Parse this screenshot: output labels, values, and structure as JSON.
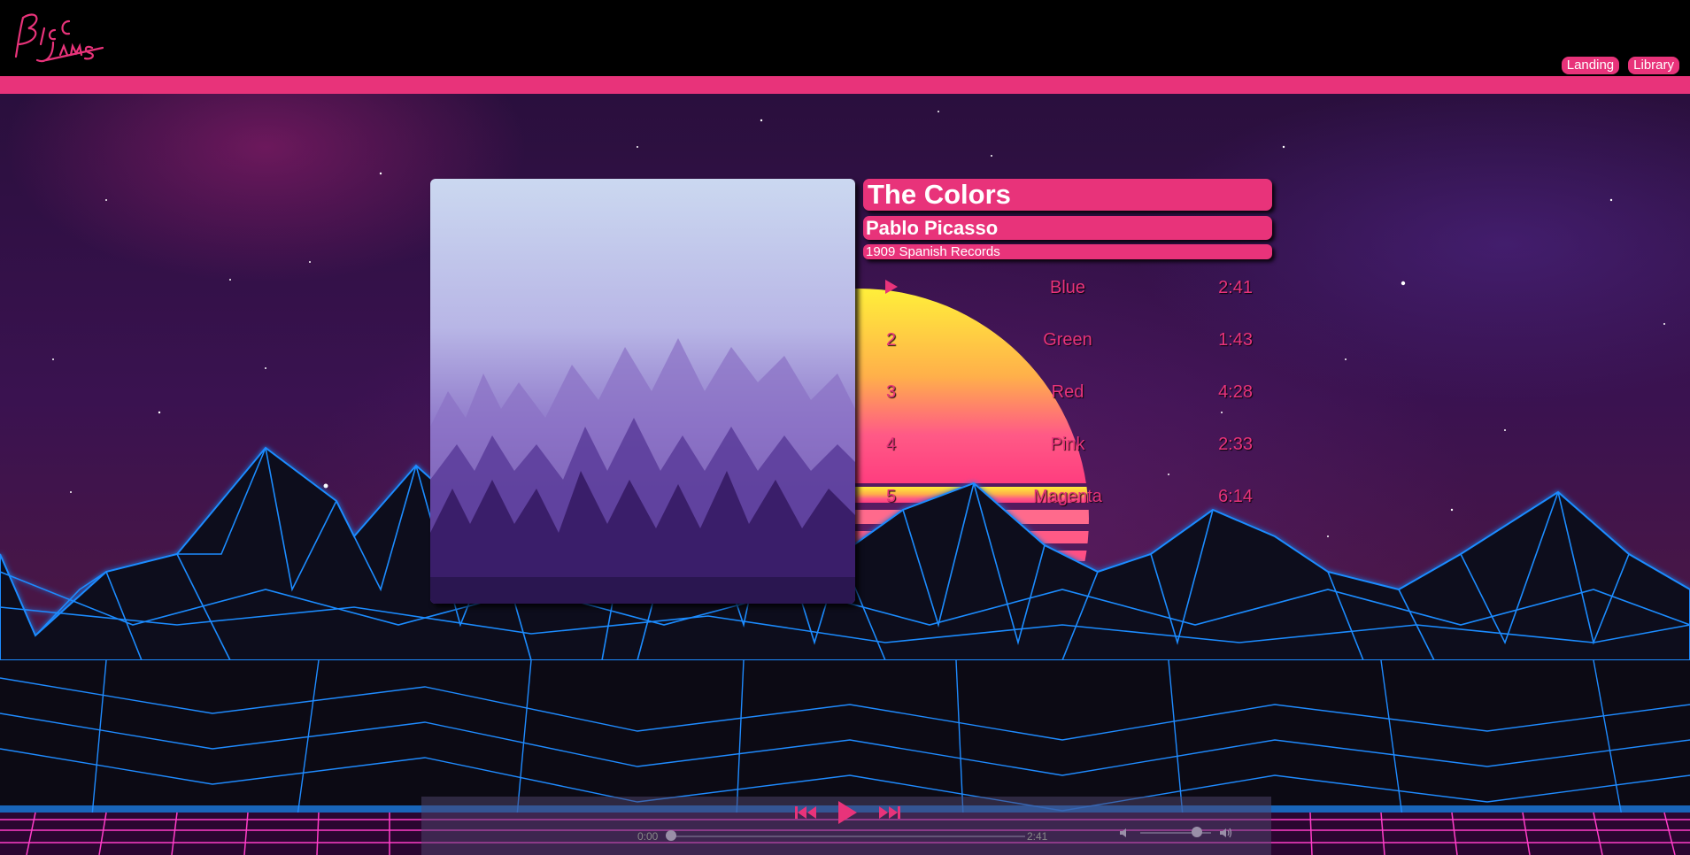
{
  "nav": {
    "landing": "Landing",
    "library": "Library"
  },
  "album": {
    "title": "The Colors",
    "artist": "Pablo Picasso",
    "release": "1909 Spanish Records"
  },
  "songs": [
    {
      "number": "1",
      "title": "Blue",
      "duration": "2:41",
      "playing": true
    },
    {
      "number": "2",
      "title": "Green",
      "duration": "1:43"
    },
    {
      "number": "3",
      "title": "Red",
      "duration": "4:28"
    },
    {
      "number": "4",
      "title": "Pink",
      "duration": "2:33"
    },
    {
      "number": "5",
      "title": "Magenta",
      "duration": "6:14"
    }
  ],
  "player": {
    "current_time": "0:00",
    "total_time": "2:41",
    "seek_fraction": 0.0,
    "volume_fraction": 0.8
  },
  "colors": {
    "accent": "#e8337a",
    "grid": "#1f8bff"
  },
  "icons": [
    "logo",
    "play-icon",
    "previous-icon",
    "next-icon",
    "volume-down-icon",
    "volume-up-icon"
  ]
}
